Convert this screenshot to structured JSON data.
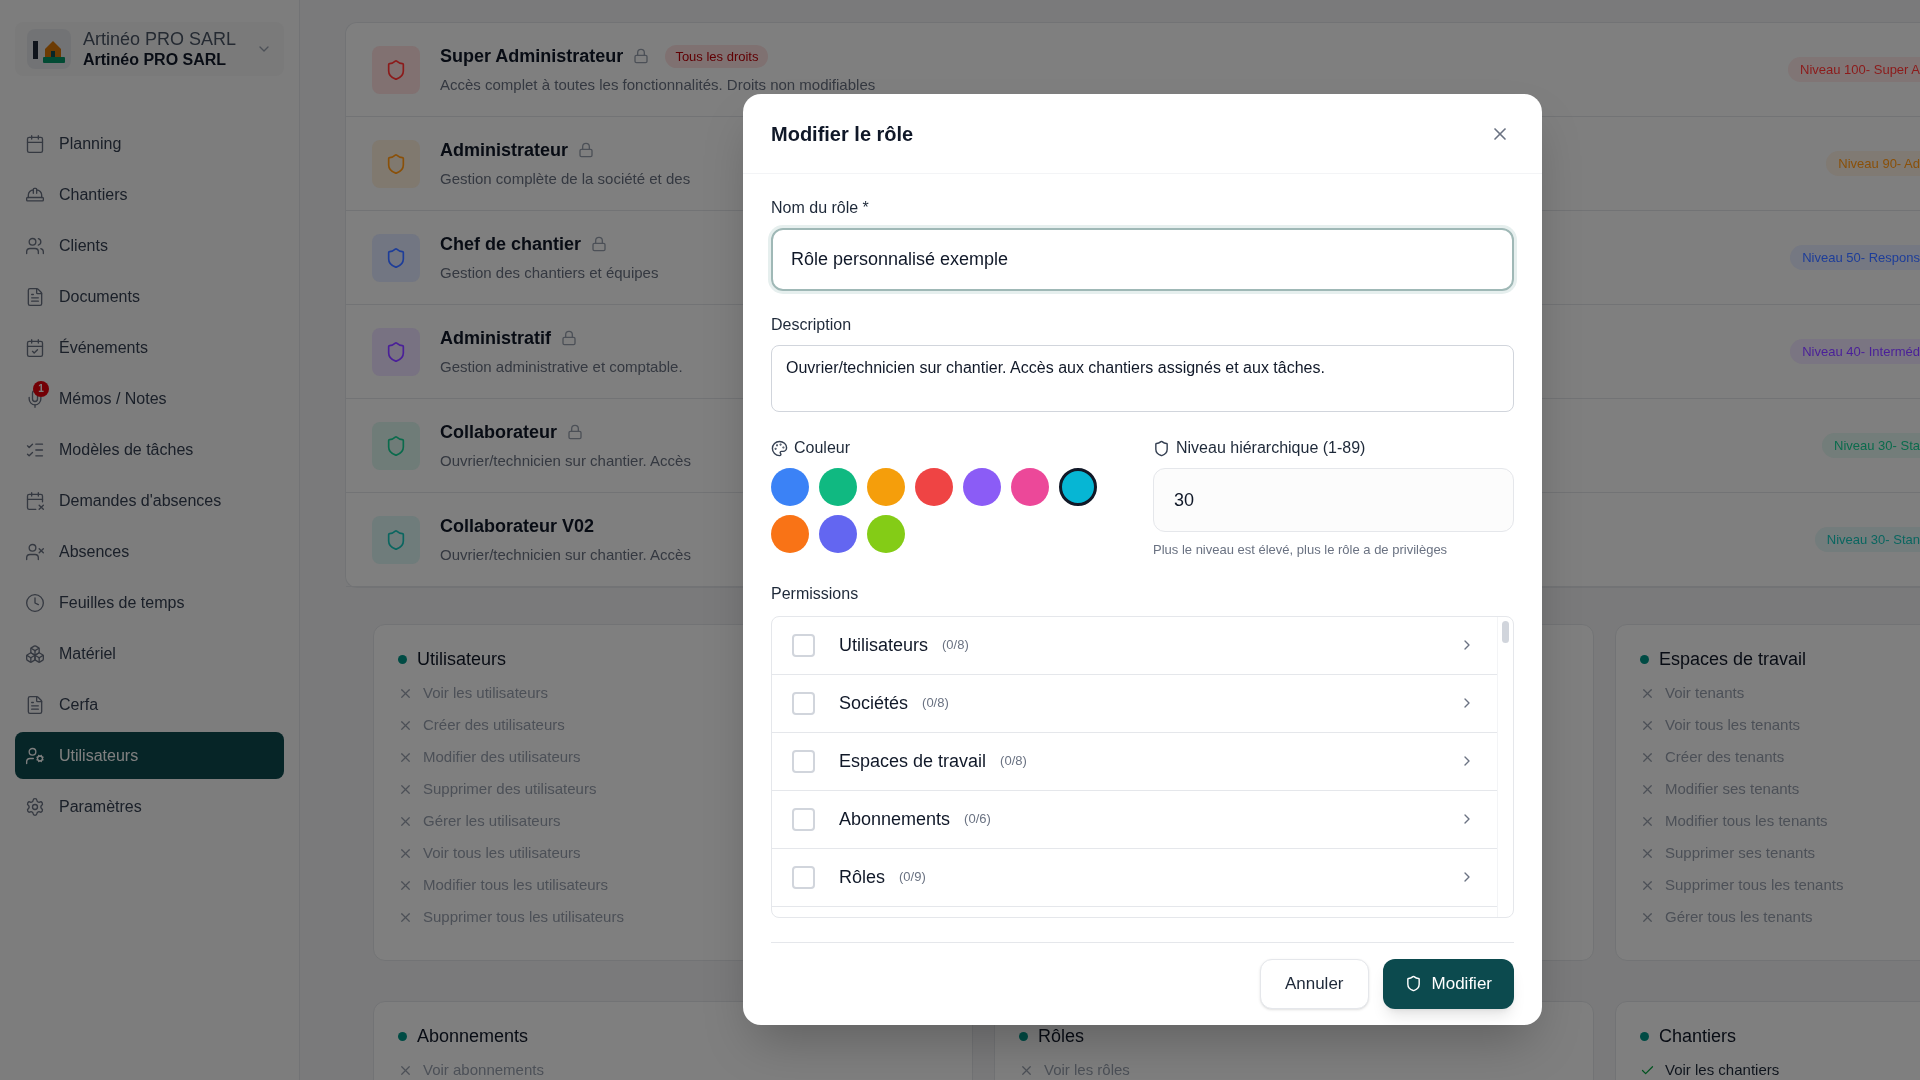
{
  "sidebar": {
    "company": {
      "name": "Artinéo PRO SARL",
      "subtitle": "Artinéo PRO SARL"
    },
    "items": [
      {
        "label": "Planning",
        "selected": false
      },
      {
        "label": "Chantiers",
        "selected": false
      },
      {
        "label": "Clients",
        "selected": false
      },
      {
        "label": "Documents",
        "selected": false
      },
      {
        "label": "Événements",
        "selected": false
      },
      {
        "label": "Mémos / Notes",
        "selected": false,
        "badge": "1"
      },
      {
        "label": "Modèles de tâches",
        "selected": false
      },
      {
        "label": "Demandes d'absences",
        "selected": false
      },
      {
        "label": "Absences",
        "selected": false
      },
      {
        "label": "Feuilles de temps",
        "selected": false
      },
      {
        "label": "Matériel",
        "selected": false
      },
      {
        "label": "Cerfa",
        "selected": false
      },
      {
        "label": "Utilisateurs",
        "selected": true
      },
      {
        "label": "Paramètres",
        "selected": false
      }
    ]
  },
  "roles": [
    {
      "name": "Super Administrateur",
      "locked": true,
      "tag": "Tous les droits",
      "description": "Accès complet à toutes les fonctionnalités. Droits non modifiables",
      "level": "Niveau 100- Super A",
      "color": "#8c1a1a"
    },
    {
      "name": "Administrateur",
      "locked": true,
      "description": "Gestion complète de la société et des",
      "level": "Niveau 90- Ad",
      "color": "#8a5008"
    },
    {
      "name": "Chef de chantier",
      "locked": true,
      "description": "Gestion des chantiers et équipes",
      "level": "Niveau 50- Respons",
      "color": "#1d3d99"
    },
    {
      "name": "Administratif",
      "locked": true,
      "description": "Gestion administrative et comptable.",
      "level": "Niveau 40- Interméd",
      "color": "#4a1f99"
    },
    {
      "name": "Collaborateur",
      "locked": true,
      "description": "Ouvrier/technicien sur chantier. Accès",
      "level": "Niveau 30- Sta",
      "color": "#0a6b4c"
    },
    {
      "name": "Collaborateur V02",
      "locked": false,
      "description": "Ouvrier/technicien sur chantier. Accès",
      "level": "Niveau 30- Stan",
      "color": "#0a6660"
    }
  ],
  "permission_rows": [
    {
      "cards": [
        {
          "title": "Utilisateurs",
          "items": [
            {
              "label": "Voir les utilisateurs",
              "granted": false
            },
            {
              "label": "Créer des utilisateurs",
              "granted": false
            },
            {
              "label": "Modifier des utilisateurs",
              "granted": false
            },
            {
              "label": "Supprimer des utilisateurs",
              "granted": false
            },
            {
              "label": "Gérer les utilisateurs",
              "granted": false
            },
            {
              "label": "Voir tous les utilisateurs",
              "granted": false
            },
            {
              "label": "Modifier tous les utilisateurs",
              "granted": false
            },
            {
              "label": "Supprimer tous les utilisateurs",
              "granted": false
            }
          ]
        },
        {
          "title": "Espaces de travail",
          "items": [
            {
              "label": "Voir tenants",
              "granted": false
            },
            {
              "label": "Voir tous les tenants",
              "granted": false
            },
            {
              "label": "Créer des tenants",
              "granted": false
            },
            {
              "label": "Modifier ses tenants",
              "granted": false
            },
            {
              "label": "Modifier tous les tenants",
              "granted": false
            },
            {
              "label": "Supprimer ses tenants",
              "granted": false
            },
            {
              "label": "Supprimer tous les tenants",
              "granted": false
            },
            {
              "label": "Gérer tous les tenants",
              "granted": false
            }
          ]
        }
      ]
    },
    {
      "cards": [
        {
          "title": "Abonnements",
          "items": [
            {
              "label": "Voir abonnements",
              "granted": false
            }
          ]
        },
        {
          "title": "Rôles",
          "items": [
            {
              "label": "Voir les rôles",
              "granted": false
            }
          ]
        },
        {
          "title": "Chantiers",
          "items": [
            {
              "label": "Voir les chantiers",
              "granted": true
            }
          ]
        }
      ]
    }
  ],
  "dialog": {
    "title": "Modifier le rôle",
    "name_label": "Nom du rôle *",
    "name_value": "Rôle personnalisé exemple",
    "description_label": "Description",
    "description_value": "Ouvrier/technicien sur chantier. Accès aux chantiers assignés et aux tâches.",
    "color_label": "Couleur",
    "colors": [
      {
        "color": "#3b82f6",
        "selected": false
      },
      {
        "color": "#10b981",
        "selected": false
      },
      {
        "color": "#f59e0b",
        "selected": false
      },
      {
        "color": "#ef4444",
        "selected": false
      },
      {
        "color": "#8b5cf6",
        "selected": false
      },
      {
        "color": "#ec4899",
        "selected": false
      },
      {
        "color": "#06b6d4",
        "selected": true
      },
      {
        "color": "#f97316",
        "selected": false
      },
      {
        "color": "#6366f1",
        "selected": false
      },
      {
        "color": "#84cc16",
        "selected": false
      }
    ],
    "level_label": "Niveau hiérarchique (1-89)",
    "level_value": "30",
    "level_hint": "Plus le niveau est élevé, plus le rôle a de privilèges",
    "permissions_label": "Permissions",
    "permissions": [
      {
        "label": "Utilisateurs",
        "count": "(0/8)",
        "checked": false
      },
      {
        "label": "Sociétés",
        "count": "(0/8)",
        "checked": false
      },
      {
        "label": "Espaces de travail",
        "count": "(0/8)",
        "checked": false
      },
      {
        "label": "Abonnements",
        "count": "(0/6)",
        "checked": false
      },
      {
        "label": "Rôles",
        "count": "(0/9)",
        "checked": false
      }
    ],
    "buttons": {
      "cancel": "Annuler",
      "submit": "Modifier"
    }
  }
}
